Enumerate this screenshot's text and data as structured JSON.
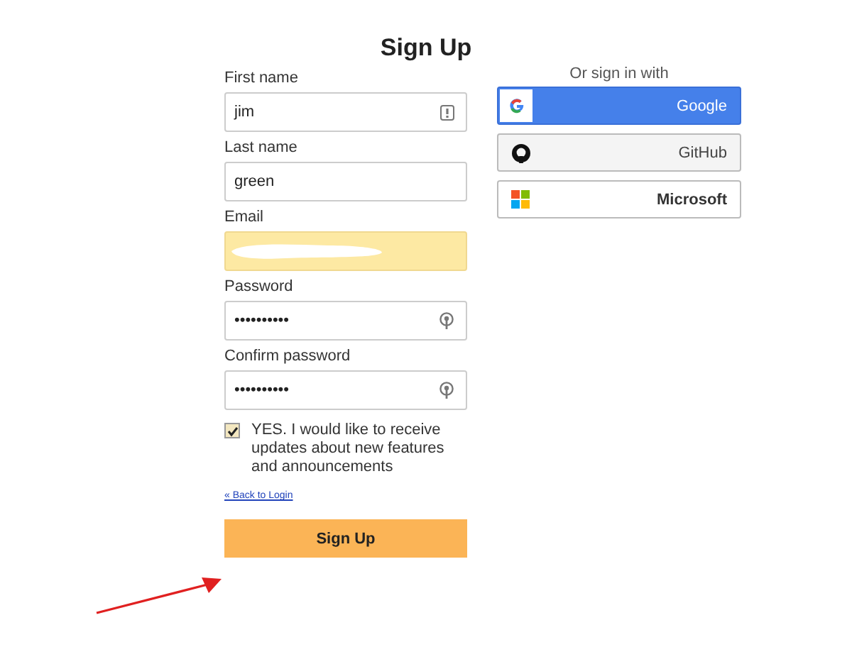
{
  "title": "Sign Up",
  "fields": [
    {
      "kind": "hinted",
      "label": "First name",
      "value": "jim",
      "autofilled": false
    },
    {
      "kind": "text",
      "label": "Last name",
      "value": "green",
      "autofilled": false
    },
    {
      "kind": "redacted",
      "label": "Email",
      "autofilled": true
    },
    {
      "kind": "password",
      "label": "Password",
      "value": "••••••••••",
      "autofilled": false
    },
    {
      "kind": "password",
      "label": "Confirm password",
      "value": "••••••••••",
      "autofilled": false
    }
  ],
  "consent": {
    "checked": true,
    "label": "YES. I would like to receive updates about new features and announcements"
  },
  "back_link": "« Back to Login",
  "submit": "Sign Up",
  "social": {
    "heading": "Or sign in with",
    "buttons": [
      {
        "kind": "google",
        "label": "Google"
      },
      {
        "kind": "github",
        "label": "GitHub"
      },
      {
        "kind": "microsoft",
        "label": "Microsoft"
      }
    ]
  }
}
